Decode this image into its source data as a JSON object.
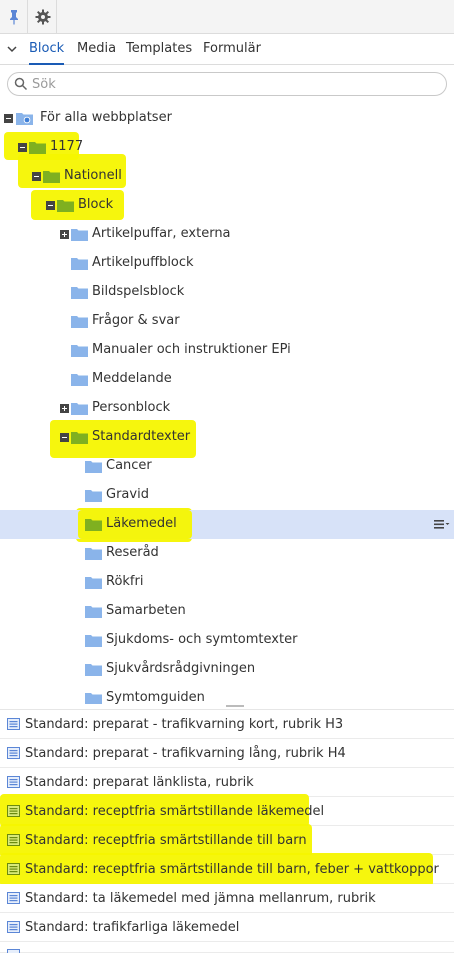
{
  "tabs": [
    "Block",
    "Media",
    "Templates",
    "Formulär"
  ],
  "search": {
    "placeholder": "Sök",
    "value": ""
  },
  "tree": {
    "root": "För alla webbplatser",
    "nodes": [
      "1177",
      "Nationell",
      "Block",
      "Artikelpuffar, externa",
      "Artikelpuffblock",
      "Bildspelsblock",
      "Frågor & svar",
      "Manualer och instruktioner EPi",
      "Meddelande",
      "Personblock",
      "Standardtexter",
      "Cancer",
      "Gravid",
      "Läkemedel",
      "Reseråd",
      "Rökfri",
      "Samarbeten",
      "Sjukdoms- och symtomtexter",
      "Sjukvårdsrådgivningen",
      "Symtomguiden"
    ],
    "selected": "Läkemedel"
  },
  "blocks": [
    "Standard: preparat - trafikvarning kort, rubrik H3",
    "Standard: preparat - trafikvarning lång, rubrik H4",
    "Standard: preparat länklista, rubrik",
    "Standard: receptfria smärtstillande läkemedel",
    "Standard: receptfria smärtstillande till barn",
    "Standard: receptfria smärtstillande till barn, feber + vattkoppor",
    "Standard: ta läkemedel med jämna mellanrum, rubrik",
    "Standard: trafikfarliga läkemedel"
  ],
  "colors": {
    "accent": "#1a5bb5",
    "folder": "#8ab4ea",
    "folder_highlighted": "#7fb020",
    "highlight": "#f5f500",
    "selected_row": "#d7e2f8"
  }
}
